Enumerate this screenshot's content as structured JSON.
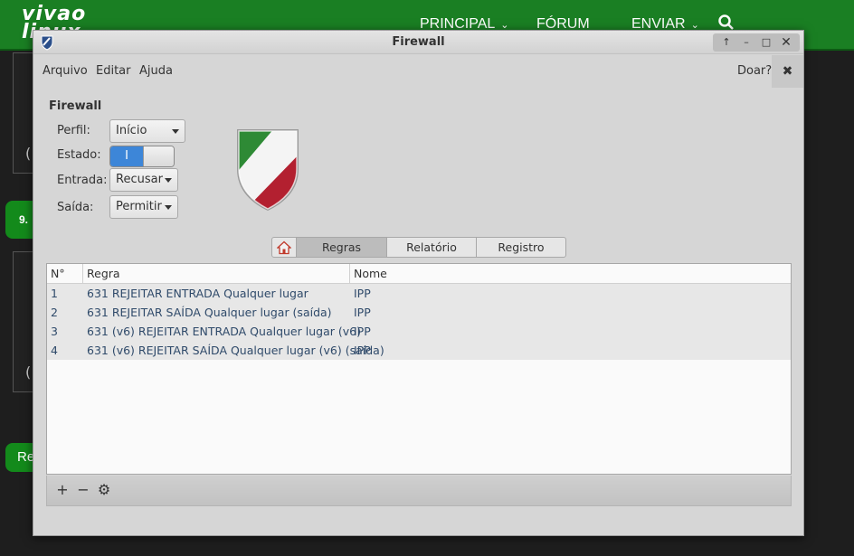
{
  "site": {
    "logo_line1": "vivao",
    "logo_line2": "linux",
    "nav": [
      "PRINCIPAL",
      "FÓRUM",
      "ENVIAR"
    ],
    "side_number": "9.",
    "side_text_a": "(",
    "side_text_b": "(",
    "side_button": "Re"
  },
  "window": {
    "title": "Firewall",
    "controls": {
      "pin": "↑",
      "minimize": "–",
      "maximize": "□",
      "close": "✕"
    }
  },
  "menu": {
    "file": "Arquivo",
    "edit": "Editar",
    "help": "Ajuda",
    "donate": "Doar?",
    "donate_close": "✖"
  },
  "firewall": {
    "section_title": "Firewall",
    "profile_label": "Perfil:",
    "profile_value": "Início",
    "status_label": "Estado:",
    "status_on_text": "I",
    "incoming_label": "Entrada:",
    "incoming_value": "Recusar",
    "outgoing_label": "Saída:",
    "outgoing_value": "Permitir"
  },
  "tabs": [
    "Regras",
    "Relatório",
    "Registro"
  ],
  "table": {
    "columns": [
      "N°",
      "Regra",
      "Nome"
    ],
    "rows": [
      [
        "1",
        "631 REJEITAR ENTRADA Qualquer lugar",
        "IPP"
      ],
      [
        "2",
        "631 REJEITAR SAÍDA Qualquer lugar (saída)",
        "IPP"
      ],
      [
        "3",
        "631 (v6) REJEITAR ENTRADA Qualquer lugar (v6)",
        "IPP"
      ],
      [
        "4",
        "631 (v6) REJEITAR SAÍDA Qualquer lugar (v6) (saída)",
        "IPP"
      ]
    ]
  },
  "bottom": {
    "add": "+",
    "remove": "−",
    "settings": "⚙"
  },
  "colors": {
    "site_green": "#1a7f23",
    "switch_on": "#3d86d8",
    "row_text": "#2f4a6a"
  }
}
